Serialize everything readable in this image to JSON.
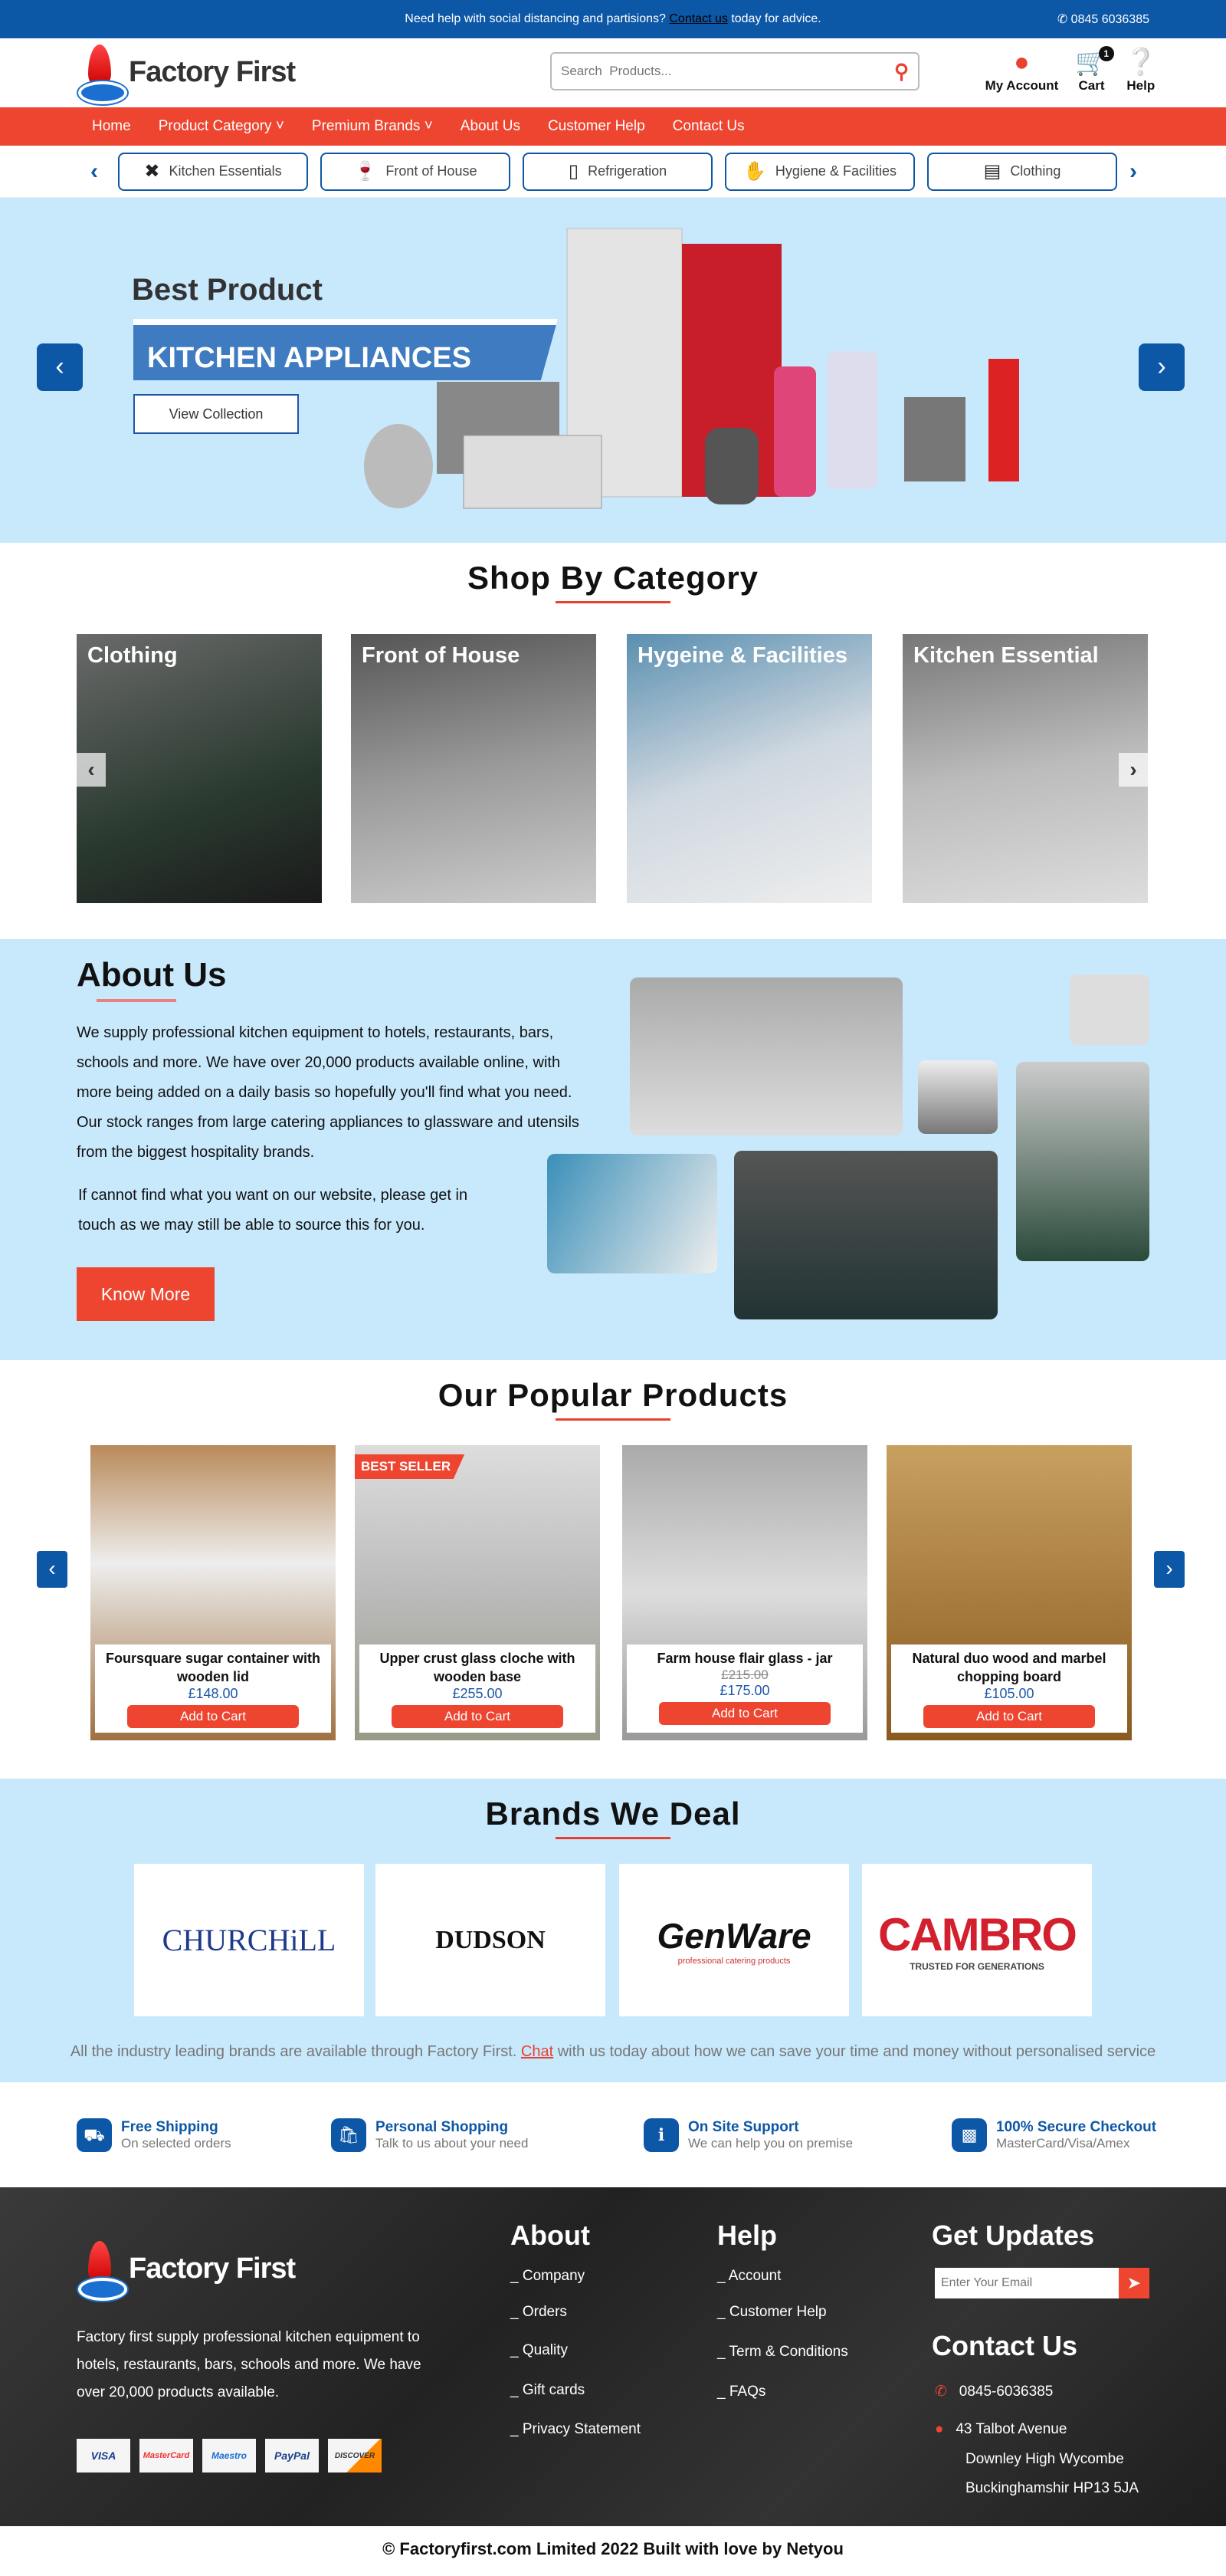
{
  "topbar": {
    "message": "Need help with social distancing and  partisions?",
    "link": "Contact us",
    "message_end": "today for advice.",
    "phone": "0845 6036385"
  },
  "header": {
    "logo": "Factory First",
    "search_placeholder": "Search  Products...",
    "account": "My Account",
    "cart": "Cart",
    "cart_count": "1",
    "help": "Help"
  },
  "nav": [
    "Home",
    "Product Category",
    "Premium Brands",
    "About Us",
    "Customer Help",
    "Contact Us"
  ],
  "categories": [
    {
      "label": "Kitchen Essentials",
      "icon": "utensils-icon"
    },
    {
      "label": "Front of House",
      "icon": "wine-glasses-icon"
    },
    {
      "label": "Refrigeration",
      "icon": "fridge-icon"
    },
    {
      "label": "Hygiene & Facilities",
      "icon": "hand-wash-icon"
    },
    {
      "label": "Clothing",
      "icon": "chef-coat-icon"
    }
  ],
  "hero": {
    "subtitle": "Best Product",
    "title": "KITCHEN APPLIANCES",
    "button": "View Collection"
  },
  "shop": {
    "title": "Shop By Category",
    "cards": [
      "Clothing",
      "Front of House",
      "Hygeine & Facilities",
      "Kitchen Essential"
    ]
  },
  "about": {
    "title": "About Us",
    "p1": "We supply professional kitchen equipment to hotels, restaurants, bars, schools and more. We have over 20,000 products available online, with more being added on a daily basis so hopefully you'll find what you need. Our stock ranges from large catering appliances  to glassware and utensils from the biggest hospitality brands.",
    "p2": "If cannot find what you want on our website, please get in touch as we may still be able to source this for you.",
    "button": "Know More"
  },
  "popular": {
    "title": "Our Popular Products",
    "badge": "BEST SELLER",
    "add": "Add to Cart",
    "products": [
      {
        "name": "Foursquare sugar container with wooden lid",
        "price": "£148.00"
      },
      {
        "name": "Upper crust glass cloche with wooden base",
        "price": "£255.00"
      },
      {
        "name": "Farm house flair glass - jar",
        "old_price": "£215.00",
        "price": "£175.00"
      },
      {
        "name": "Natural duo wood and marbel chopping board",
        "price": "£105.00"
      }
    ]
  },
  "brands": {
    "title": "Brands We Deal",
    "logos": [
      "CHURCHiLL",
      "DUDSON",
      "GenWare",
      "CAMBRO"
    ],
    "cambro_tag": "TRUSTED FOR GENERATIONS",
    "genware_tag": "professional catering products",
    "text1": "All the industry leading brands are available through Factory First.",
    "chat": "Chat",
    "text2": "with us today about how we can save your time and money without personalised service"
  },
  "features": [
    {
      "title": "Free Shipping",
      "sub": "On selected orders"
    },
    {
      "title": "Personal Shopping",
      "sub": "Talk to us about your need"
    },
    {
      "title": "On Site Support",
      "sub": "We can help you on premise"
    },
    {
      "title": "100% Secure Checkout",
      "sub": "MasterCard/Visa/Amex"
    }
  ],
  "footer": {
    "logo": "Factory First",
    "desc": "Factory first supply professional kitchen equipment to hotels, restaurants, bars, schools and more. We have over 20,000 products available.",
    "about_title": "About",
    "about_links": [
      "_ Company",
      "_ Orders",
      "_ Quality",
      "_ Gift cards",
      "_ Privacy Statement"
    ],
    "help_title": "Help",
    "help_links": [
      "_ Account",
      "_ Customer Help",
      "_ Term & Conditions",
      "_ FAQs"
    ],
    "updates_title": "Get Updates",
    "email_placeholder": "Enter Your Email",
    "contact_title": "Contact Us",
    "phone": "0845-6036385",
    "address": [
      "43 Talbot Avenue",
      "Downley High Wycombe",
      "Buckinghamshir HP13 5JA"
    ],
    "payments": [
      "VISA",
      "MasterCard",
      "Maestro",
      "PayPal",
      "DISCOVER"
    ]
  },
  "copyright": "© Factoryfirst.com Limited 2022 Built with love by Netyou",
  "colors": {
    "blue": "#0d57a7",
    "red": "#ee4530",
    "light_blue": "#c8e8fc"
  }
}
